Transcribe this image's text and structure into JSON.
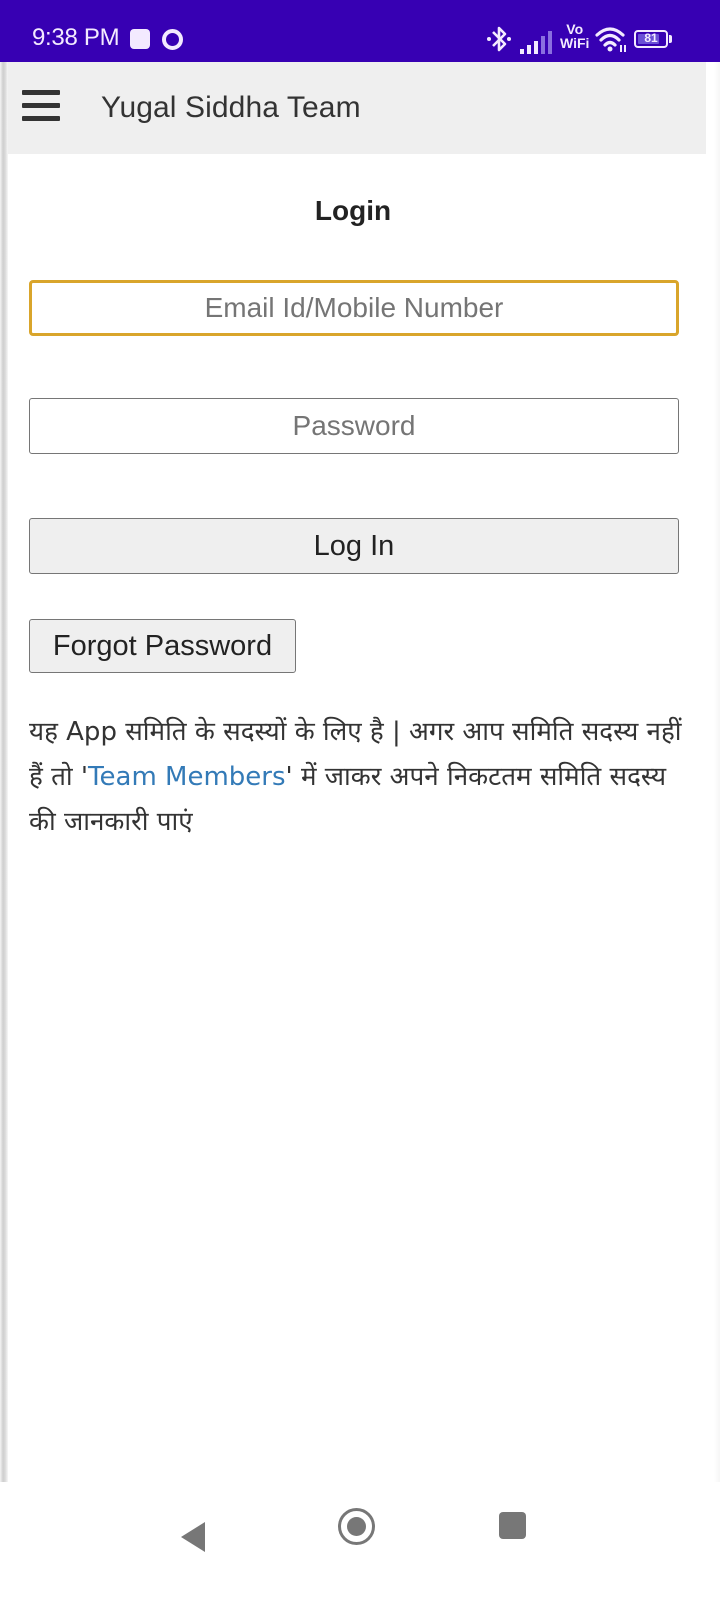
{
  "status_bar": {
    "time": "9:38 PM",
    "notification_icons": [
      "square-notification-icon",
      "circle-notification-icon"
    ],
    "system_icons": [
      "bluetooth-icon",
      "signal-icon",
      "vowifi-icon",
      "wifi-icon",
      "battery-icon"
    ],
    "vowifi_label_top": "Vo",
    "vowifi_label_bottom": "WiFi",
    "battery_percent": 81,
    "battery_label": "81"
  },
  "header": {
    "menu_icon": "hamburger-menu-icon",
    "title": "Yugal Siddha Team",
    "background_color": "#efefef"
  },
  "login_form": {
    "heading": "Login",
    "email": {
      "value": "",
      "placeholder": "Email Id/Mobile Number",
      "focused": true,
      "focus_color": "#d9a52b"
    },
    "password": {
      "value": "",
      "placeholder": "Password"
    },
    "login_button_label": "Log In",
    "forgot_password_label": "Forgot Password"
  },
  "info": {
    "text_before_link": "यह App समिति के सदस्यों के लिए है | अगर आप समिति सदस्य नहीं हैं तो '",
    "link_text": "Team Members",
    "text_after_link": "' में जाकर अपने निकटतम समिति सदस्य की जानकारी पाएं",
    "link_color": "#337ab7"
  },
  "nav_bar": {
    "buttons": [
      "back-icon",
      "home-icon",
      "recents-icon"
    ]
  },
  "colors": {
    "status_bar": "#3700b3",
    "text_primary": "#333333"
  }
}
